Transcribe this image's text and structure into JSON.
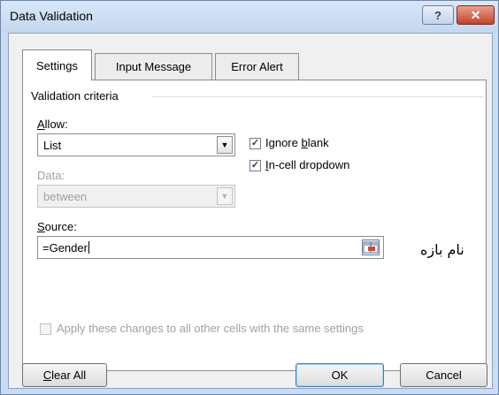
{
  "window": {
    "title": "Data Validation",
    "help_glyph": "?",
    "close_glyph": "✕"
  },
  "tabs": [
    {
      "label": "Settings",
      "active": true
    },
    {
      "label": "Input Message",
      "active": false
    },
    {
      "label": "Error Alert",
      "active": false
    }
  ],
  "settings": {
    "group_label": "Validation criteria",
    "allow": {
      "label_mnemonic": "A",
      "label_rest": "llow:",
      "value": "List"
    },
    "data": {
      "label": "Data:",
      "value": "between"
    },
    "ignore_blank": {
      "checked": true,
      "label_pre": "Ignore ",
      "label_mnemonic": "b",
      "label_post": "lank"
    },
    "in_cell_dropdown": {
      "checked": true,
      "label_mnemonic": "I",
      "label_rest": "n-cell dropdown"
    },
    "source": {
      "label_mnemonic": "S",
      "label_rest": "ource:",
      "value": "=Gender"
    },
    "apply_all": {
      "checked": false,
      "label": "Apply these changes to all other cells with the same settings"
    }
  },
  "annotation": "نام بازه",
  "buttons": {
    "clear_all_mnemonic": "C",
    "clear_all_rest": "lear All",
    "ok": "OK",
    "cancel": "Cancel"
  },
  "colors": {
    "title_bar": "#c9dcf3",
    "close_button": "#c3432b",
    "check_mark": "#1a3b8c"
  }
}
